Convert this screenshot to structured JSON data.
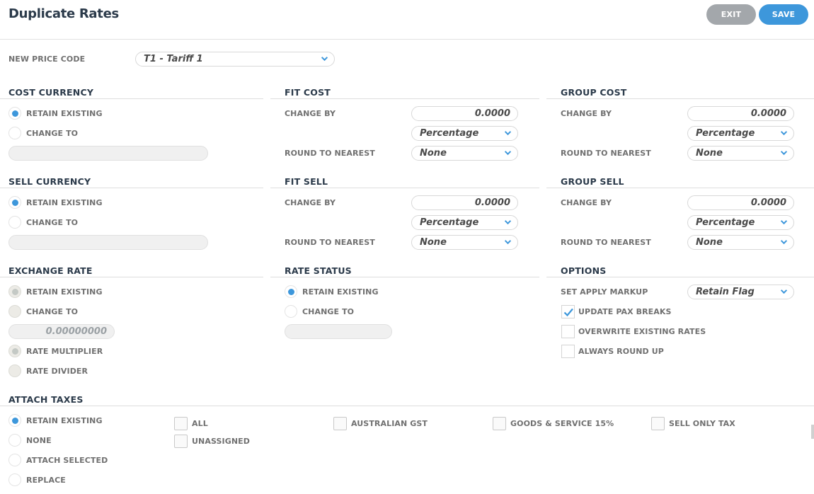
{
  "header": {
    "title": "Duplicate Rates",
    "exit_label": "EXIT",
    "save_label": "SAVE"
  },
  "new_price_code": {
    "label": "NEW PRICE CODE",
    "value": "T1 - Tariff 1"
  },
  "common": {
    "retain_existing": "RETAIN EXISTING",
    "change_to": "CHANGE TO",
    "change_by": "CHANGE BY",
    "round_to_nearest": "ROUND TO NEAREST",
    "zero": "0.0000",
    "percentage": "Percentage",
    "none": "None"
  },
  "cost_currency": {
    "title": "COST CURRENCY"
  },
  "fit_cost": {
    "title": "FIT COST"
  },
  "group_cost": {
    "title": "GROUP COST"
  },
  "sell_currency": {
    "title": "SELL CURRENCY"
  },
  "fit_sell": {
    "title": "FIT SELL"
  },
  "group_sell": {
    "title": "GROUP SELL"
  },
  "exchange_rate": {
    "title": "EXCHANGE RATE",
    "value": "0.00000000",
    "rate_multiplier": "RATE MULTIPLIER",
    "rate_divider": "RATE DIVIDER"
  },
  "rate_status": {
    "title": "RATE STATUS"
  },
  "options": {
    "title": "OPTIONS",
    "set_apply_markup": "SET APPLY MARKUP",
    "markup_value": "Retain Flag",
    "update_pax_breaks": "UPDATE PAX BREAKS",
    "overwrite_existing_rates": "OVERWRITE EXISTING RATES",
    "always_round_up": "ALWAYS ROUND UP"
  },
  "attach_taxes": {
    "title": "ATTACH TAXES",
    "modes": [
      "RETAIN EXISTING",
      "NONE",
      "ATTACH SELECTED",
      "REPLACE"
    ],
    "taxes": [
      "ALL",
      "UNASSIGNED",
      "AUSTRALIAN GST",
      "GOODS & SERVICE 15%",
      "SELL ONLY TAX"
    ]
  },
  "colors": {
    "accent": "#3d97db",
    "exit_button": "#a3a7ab",
    "heading": "#2b3a4a"
  },
  "icons": [
    "chevron-down-icon",
    "checkmark-icon"
  ]
}
